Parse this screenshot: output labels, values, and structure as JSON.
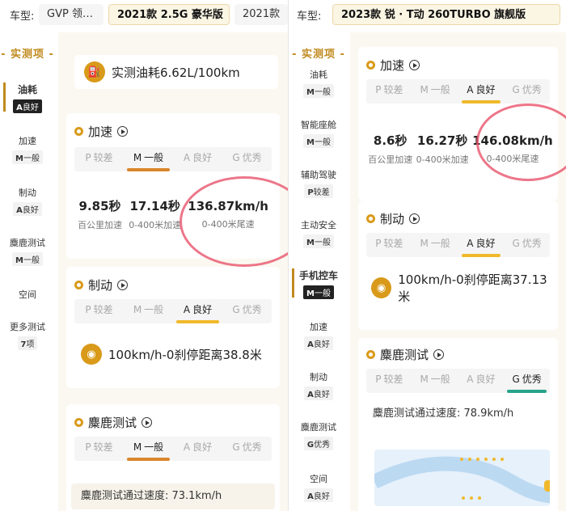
{
  "left": {
    "topbar": {
      "car_label": "车型:",
      "chip_cut": "GVP 领…",
      "selected": "2021款 2.5G 豪华版",
      "chip_next": "2021款"
    },
    "sidebar": {
      "header": "- 实测项 -",
      "items": [
        {
          "name": "油耗",
          "grade_letter": "A",
          "grade_text": "良好",
          "active": true
        },
        {
          "name": "加速",
          "grade_letter": "M",
          "grade_text": "一般"
        },
        {
          "name": "制动",
          "grade_letter": "A",
          "grade_text": "良好"
        },
        {
          "name": "麋鹿测试",
          "grade_letter": "M",
          "grade_text": "一般"
        },
        {
          "name": "空间"
        },
        {
          "name": "更多测试",
          "grade_letter": "7",
          "grade_text": "项"
        }
      ]
    },
    "fuel": {
      "text": "实测油耗6.62L/100km"
    },
    "accel": {
      "title": "加速",
      "grades": [
        {
          "letter": "P",
          "text": "较差"
        },
        {
          "letter": "M",
          "text": "一般",
          "on": true
        },
        {
          "letter": "A",
          "text": "良好"
        },
        {
          "letter": "G",
          "text": "优秀"
        }
      ],
      "stats": [
        {
          "value": "9.85秒",
          "key": "百公里加速"
        },
        {
          "value": "17.14秒",
          "key": "0-400米加速"
        },
        {
          "value": "136.87km/h",
          "key": "0-400米尾速"
        }
      ]
    },
    "brake": {
      "title": "制动",
      "grades": [
        {
          "letter": "P",
          "text": "较差"
        },
        {
          "letter": "M",
          "text": "一般"
        },
        {
          "letter": "A",
          "text": "良好",
          "on": true
        },
        {
          "letter": "G",
          "text": "优秀"
        }
      ],
      "distance": "100km/h-0刹停距离38.8米"
    },
    "moose": {
      "title": "麋鹿测试",
      "grades": [
        {
          "letter": "P",
          "text": "较差"
        },
        {
          "letter": "M",
          "text": "一般",
          "on": true
        },
        {
          "letter": "A",
          "text": "良好"
        },
        {
          "letter": "G",
          "text": "优秀"
        }
      ],
      "speed": "麋鹿测试通过速度: 73.1km/h"
    }
  },
  "right": {
    "topbar": {
      "car_label": "车型:",
      "selected": "2023款 锐 · T动 260TURBO 旗舰版"
    },
    "sidebar": {
      "header": "- 实测项 -",
      "items": [
        {
          "name": "油耗",
          "grade_letter": "M",
          "grade_text": "一般"
        },
        {
          "name": "智能座舱",
          "grade_letter": "M",
          "grade_text": "一般"
        },
        {
          "name": "辅助驾驶",
          "grade_letter": "P",
          "grade_text": "较差"
        },
        {
          "name": "主动安全",
          "grade_letter": "M",
          "grade_text": "一般"
        },
        {
          "name": "手机控车",
          "grade_letter": "M",
          "grade_text": "一般",
          "active": true
        },
        {
          "name": "加速",
          "grade_letter": "A",
          "grade_text": "良好"
        },
        {
          "name": "制动",
          "grade_letter": "A",
          "grade_text": "良好"
        },
        {
          "name": "麋鹿测试",
          "grade_letter": "G",
          "grade_text": "优秀"
        },
        {
          "name": "空间",
          "grade_letter": "A",
          "grade_text": "良好"
        }
      ]
    },
    "accel": {
      "title": "加速",
      "grades": [
        {
          "letter": "P",
          "text": "较差"
        },
        {
          "letter": "M",
          "text": "一般"
        },
        {
          "letter": "A",
          "text": "良好",
          "on": true
        },
        {
          "letter": "G",
          "text": "优秀"
        }
      ],
      "stats": [
        {
          "value": "8.6秒",
          "key": "百公里加速"
        },
        {
          "value": "16.27秒",
          "key": "0-400米加速"
        },
        {
          "value": "146.08km/h",
          "key": "0-400米尾速"
        }
      ]
    },
    "brake": {
      "title": "制动",
      "grades": [
        {
          "letter": "P",
          "text": "较差"
        },
        {
          "letter": "M",
          "text": "一般"
        },
        {
          "letter": "A",
          "text": "良好",
          "on": true
        },
        {
          "letter": "G",
          "text": "优秀"
        }
      ],
      "distance": "100km/h-0刹停距离37.13米"
    },
    "moose": {
      "title": "麋鹿测试",
      "grades": [
        {
          "letter": "P",
          "text": "较差"
        },
        {
          "letter": "M",
          "text": "一般"
        },
        {
          "letter": "A",
          "text": "良好"
        },
        {
          "letter": "G",
          "text": "优秀",
          "on": true
        }
      ],
      "speed": "麋鹿测试通过速度: 78.9km/h"
    }
  }
}
